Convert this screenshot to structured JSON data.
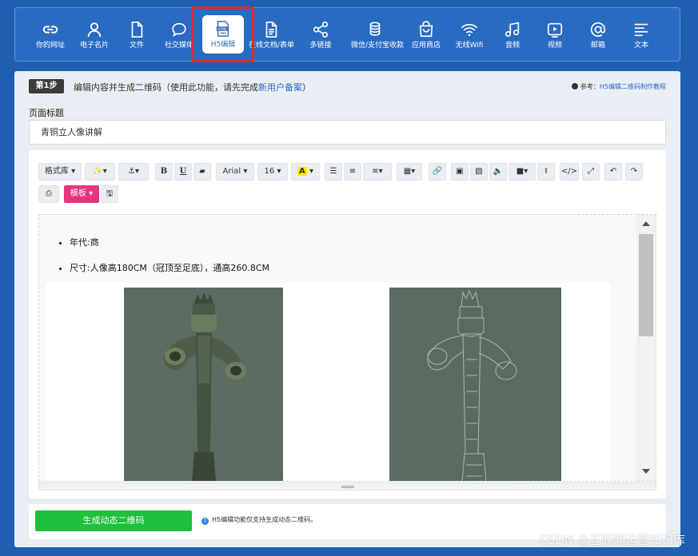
{
  "categories": [
    {
      "label": "你的网址",
      "icon": "link-icon"
    },
    {
      "label": "电子名片",
      "icon": "person-icon"
    },
    {
      "label": "文件",
      "icon": "file-icon"
    },
    {
      "label": "社交媒体",
      "icon": "chat-bubble-icon"
    },
    {
      "label": "H5编辑",
      "icon": "html-icon",
      "active": true
    },
    {
      "label": "在线文档/表单",
      "icon": "document-icon"
    },
    {
      "label": "多链接",
      "icon": "share-icon"
    },
    {
      "label": "微信/支付宝收款",
      "icon": "coins-icon"
    },
    {
      "label": "应用商店",
      "icon": "bag-icon"
    },
    {
      "label": "无线Wifi",
      "icon": "wifi-icon"
    },
    {
      "label": "音频",
      "icon": "music-icon"
    },
    {
      "label": "视频",
      "icon": "video-icon"
    },
    {
      "label": "邮箱",
      "icon": "at-icon"
    },
    {
      "label": "文本",
      "icon": "text-lines-icon"
    }
  ],
  "step": {
    "badge": "第1步",
    "text": "编辑内容并生成二维码（使用此功能，请先完成",
    "link": "新用户备案",
    "text_end": "）"
  },
  "reference": {
    "prefix": "参考：",
    "link": "H5编辑二维码制作教程"
  },
  "page_title": {
    "label": "页面标题",
    "value": "青铜立人像讲解"
  },
  "toolbar": {
    "style_lib": "格式库",
    "font": "Arial",
    "size": "16",
    "template": "模板"
  },
  "content": {
    "items": [
      "年代:商",
      "尺寸:人像高180CM（冠顶至足底），通高260.8CM"
    ]
  },
  "bottom": {
    "generate_label": "生成动态二维码",
    "note": "H5编辑功能仅支持生成动态二维码。"
  },
  "watermark": "CSDN @互联网运营知识库",
  "colors": {
    "brand_blue": "#1e5fb0",
    "generate_green": "#1ec03c",
    "template_pink": "#e8337f",
    "highlight_red": "#e3262b"
  }
}
